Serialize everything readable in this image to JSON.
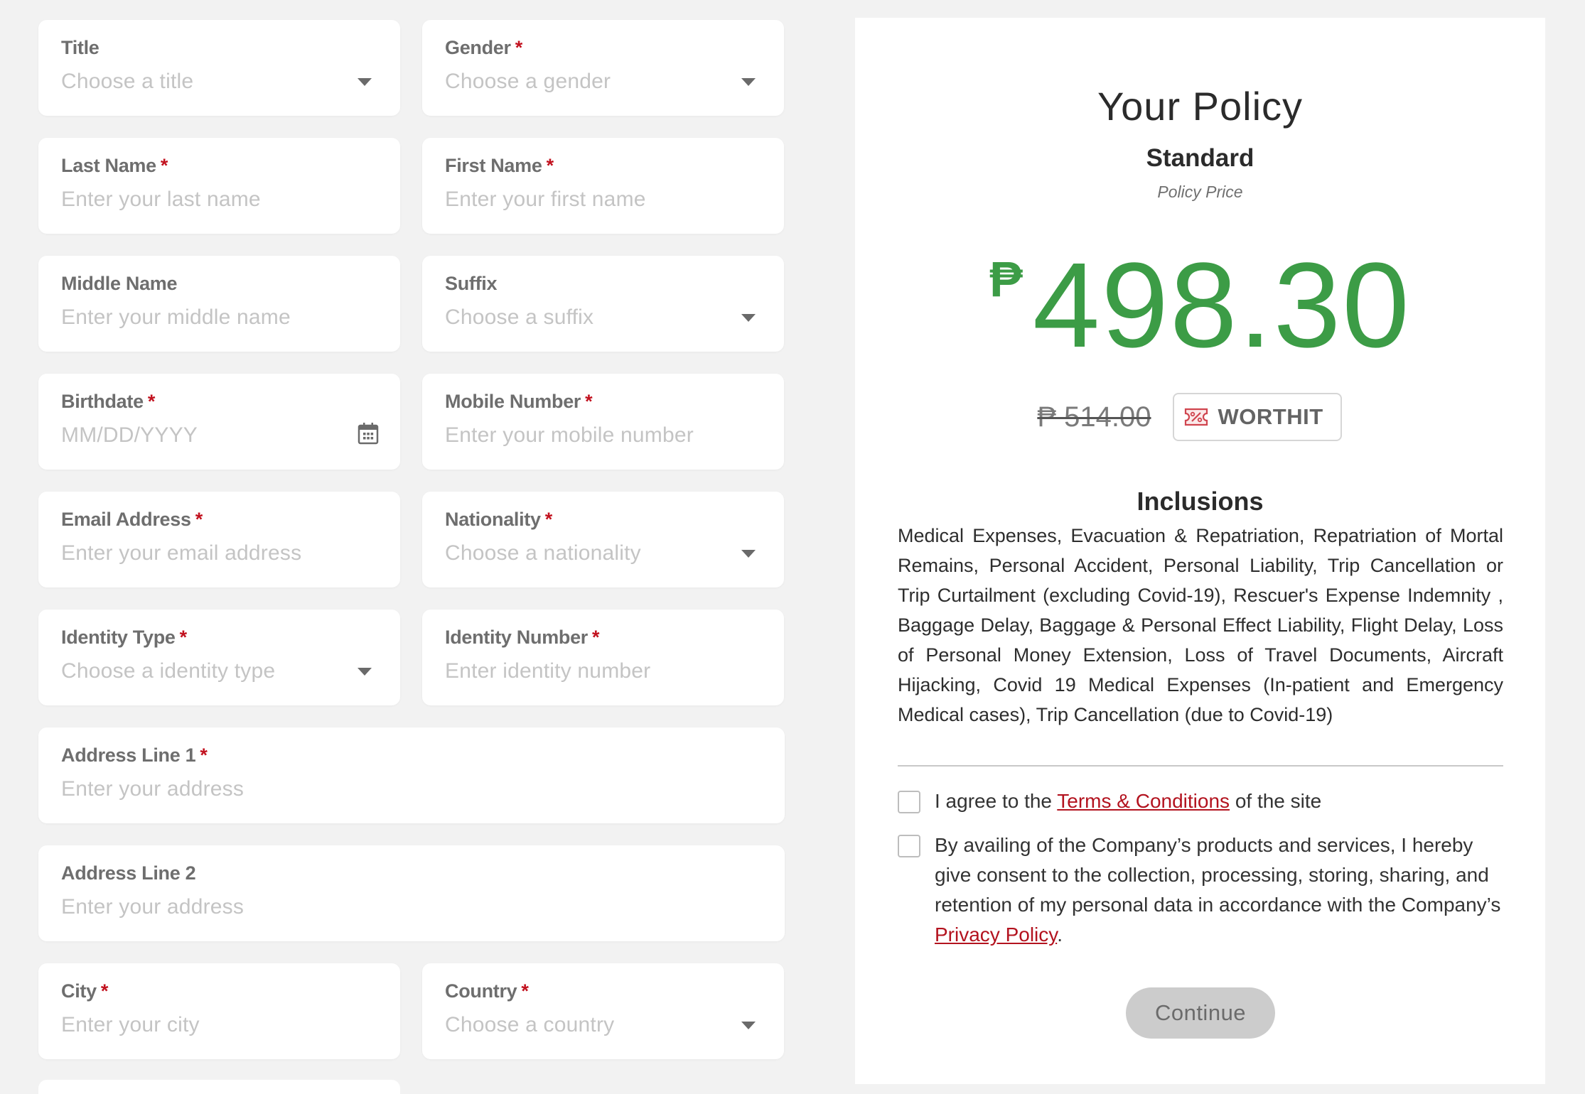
{
  "form": {
    "fields": [
      {
        "label": "Title",
        "required": false,
        "placeholder": "Choose a title",
        "type": "select"
      },
      {
        "label": "Gender",
        "required": true,
        "placeholder": "Choose a gender",
        "type": "select"
      },
      {
        "label": "Last Name",
        "required": true,
        "placeholder": "Enter your last name",
        "type": "text"
      },
      {
        "label": "First Name",
        "required": true,
        "placeholder": "Enter your first name",
        "type": "text"
      },
      {
        "label": "Middle Name",
        "required": false,
        "placeholder": "Enter your middle name",
        "type": "text"
      },
      {
        "label": "Suffix",
        "required": false,
        "placeholder": "Choose a suffix",
        "type": "select"
      },
      {
        "label": "Birthdate",
        "required": true,
        "placeholder": "MM/DD/YYYY",
        "type": "date"
      },
      {
        "label": "Mobile Number",
        "required": true,
        "placeholder": "Enter your mobile number",
        "type": "text"
      },
      {
        "label": "Email Address",
        "required": true,
        "placeholder": "Enter your email address",
        "type": "text"
      },
      {
        "label": "Nationality",
        "required": true,
        "placeholder": "Choose a nationality",
        "type": "select"
      },
      {
        "label": "Identity Type",
        "required": true,
        "placeholder": "Choose a identity type",
        "type": "select"
      },
      {
        "label": "Identity Number",
        "required": true,
        "placeholder": "Enter identity number",
        "type": "text"
      },
      {
        "label": "Address Line 1",
        "required": true,
        "placeholder": "Enter your address",
        "type": "text"
      },
      {
        "label": "Address Line 2",
        "required": false,
        "placeholder": "Enter your address",
        "type": "text"
      },
      {
        "label": "City",
        "required": true,
        "placeholder": "Enter your city",
        "type": "text"
      },
      {
        "label": "Country",
        "required": true,
        "placeholder": "Choose a country",
        "type": "select"
      }
    ],
    "required_marker": "*"
  },
  "policy": {
    "title": "Your Policy",
    "plan": "Standard",
    "price_caption": "Policy Price",
    "currency_symbol": "₱",
    "price": "498.30",
    "original_price": "₱ 514.00",
    "promo_code": "WORTHIT",
    "inclusions_title": "Inclusions",
    "inclusions_text": "Medical Expenses, Evacuation & Repatriation, Repatriation of Mortal Remains, Personal Accident, Personal Liability, Trip Cancellation or Trip Curtailment (excluding Covid-19), Rescuer's Expense Indemnity , Baggage Delay, Baggage & Personal Effect Liability, Flight Delay, Loss of Personal Money Extension, Loss of Travel Documents, Aircraft Hijacking, Covid 19 Medical Expenses (In-patient and Emergency Medical cases), Trip Cancellation (due to Covid-19)",
    "terms": {
      "checked": false,
      "prefix": "I agree to the ",
      "link": "Terms & Conditions",
      "suffix": " of the site"
    },
    "consent": {
      "checked": false,
      "prefix": "By availing of the Company’s products and services, I hereby give consent to the collection, processing, storing, sharing, and retention of my personal data in accordance with the Company’s ",
      "link": "Privacy Policy",
      "suffix": "."
    },
    "continue_label": "Continue"
  },
  "colors": {
    "price_green": "#3c9c46",
    "link_red": "#b3131f",
    "required_red": "#c2121f",
    "button_disabled": "#cccccc"
  }
}
